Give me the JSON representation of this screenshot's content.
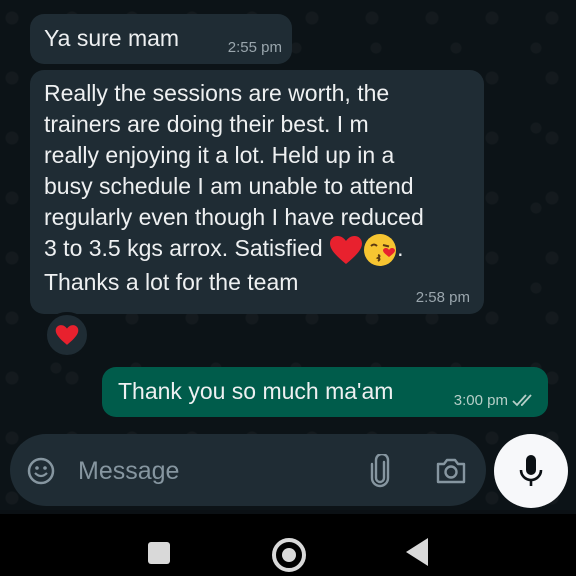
{
  "messages": [
    {
      "direction": "incoming",
      "text": "Ya sure mam",
      "time": "2:55 pm"
    },
    {
      "direction": "incoming",
      "text_lines": [
        "Really the sessions are worth, the",
        "trainers are doing their best. I m",
        "really enjoying it a lot. Held up in a",
        "busy schedule I am unable to attend",
        "regularly even though I have reduced",
        "3 to 3.5 kgs arrox. Satisfied",
        "Thanks a lot for the team"
      ],
      "emojis": [
        "red-heart",
        "face-blowing-kiss"
      ],
      "line6_suffix": ".",
      "time": "2:58 pm",
      "reaction": "red-heart"
    },
    {
      "direction": "outgoing",
      "text": "Thank you so much ma'am",
      "time": "3:00 pm",
      "status": "read-double-tick"
    }
  ],
  "composer": {
    "placeholder": "Message"
  },
  "colors": {
    "incoming_bubble": "#1f2c34",
    "outgoing_bubble": "#005c4b",
    "tick_read": "#9fc9c0"
  },
  "icons": [
    "emoji-icon",
    "attach-icon",
    "camera-icon",
    "mic-icon",
    "nav-recents-icon",
    "nav-home-icon",
    "nav-back-icon"
  ]
}
